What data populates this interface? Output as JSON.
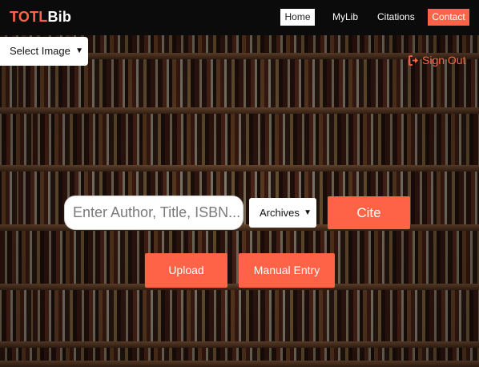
{
  "brand": {
    "logo_part1": "TOTL",
    "logo_part2": "Bib"
  },
  "nav": {
    "home": "Home",
    "mylib": "MyLib",
    "citations": "Citations",
    "contact": "Contact"
  },
  "image_select": {
    "selected": "Select Image"
  },
  "account": {
    "signout_label": "Sign Out"
  },
  "search": {
    "placeholder": "Enter Author, Title, ISBN...",
    "source_selected": "Archives",
    "cite_label": "Cite"
  },
  "actions": {
    "upload_label": "Upload",
    "manual_label": "Manual Entry"
  },
  "colors": {
    "accent": "#ff6347",
    "navbar": "#0b0b0b",
    "text_light": "#ffffff"
  }
}
